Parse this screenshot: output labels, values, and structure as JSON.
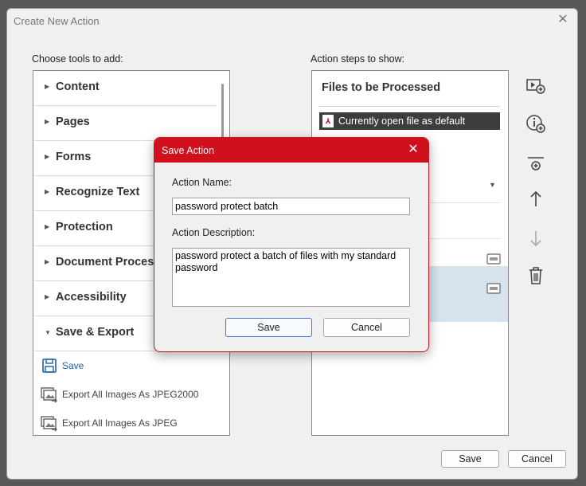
{
  "window": {
    "title": "Create New Action"
  },
  "tools": {
    "heading": "Choose tools to add:",
    "categories": [
      {
        "label": "Content"
      },
      {
        "label": "Pages"
      },
      {
        "label": "Forms"
      },
      {
        "label": "Recognize Text"
      },
      {
        "label": "Protection"
      },
      {
        "label": "Document Processing"
      },
      {
        "label": "Accessibility"
      },
      {
        "label": "Save & Export"
      }
    ],
    "items": [
      {
        "label": "Save",
        "icon": "save-icon"
      },
      {
        "label": "Export All Images As JPEG2000",
        "icon": "export-images-icon"
      },
      {
        "label": "Export All Images As JPEG",
        "icon": "export-images-icon"
      }
    ]
  },
  "steps": {
    "heading": "Action steps to show:",
    "section_title": "Files to be Processed",
    "file_source": "Currently open file as default"
  },
  "side_icons": [
    "add-step-icon",
    "add-instruction-icon",
    "add-panel-separator-icon",
    "move-up-icon",
    "move-down-icon",
    "delete-icon"
  ],
  "footer": {
    "save_label": "Save",
    "cancel_label": "Cancel"
  },
  "save_action_dialog": {
    "title": "Save Action",
    "name_label": "Action Name:",
    "name_value": "password protect batch",
    "description_label": "Action Description:",
    "description_value": "password protect a batch of files with my standard password",
    "save_label": "Save",
    "cancel_label": "Cancel"
  },
  "colors": {
    "accent": "#d0101c",
    "selected_row": "#d6e3ee",
    "file_bar": "#3d3d3d"
  }
}
